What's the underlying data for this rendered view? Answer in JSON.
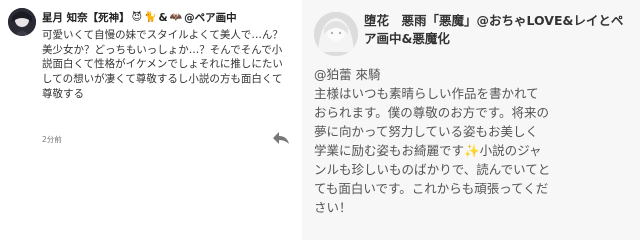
{
  "left_comment": {
    "username": "星月 知奈【死神】",
    "badges": [
      "😈",
      "🐈",
      "&",
      "🦇",
      "@ペア画中"
    ],
    "text": "可愛いくて自慢の妹でスタイルよくて美人で…ん？美少女か？どっちもいっしょか…？そんでそんで小説面白くて性格がイケメンでしょそれに推しにたいしての想いが凄くて尊敬するし小説の方も面白くて尊敬する",
    "time": "2分前",
    "icons": [
      "avatar",
      "reply-arrow-icon"
    ]
  },
  "right_comment": {
    "header": "堕花　悪雨「悪魔」@おちゃLOVE&レイとペア画中&悪魔化",
    "mention": "@狛蕾 來騎",
    "body_lines": [
      "主様はいつも素晴らしい作品を書かれて",
      "おられます。僕の尊敬のお方です。将来の",
      "夢に向かって努力している姿もお美しく",
      "学業に励む姿もお綺麗です",
      "小説のジャ",
      "ンルも珍しいものばかりで、読んでいてと",
      "ても面白いです。これからも頑張ってくだ",
      "さい！"
    ],
    "sparkle": "✨",
    "icons": [
      "avatar"
    ]
  },
  "colors": {
    "left_bg": "#ffffff",
    "right_bg": "#f7f7f7",
    "text": "#333333",
    "muted": "#777777",
    "devil": "#a64ca6"
  }
}
